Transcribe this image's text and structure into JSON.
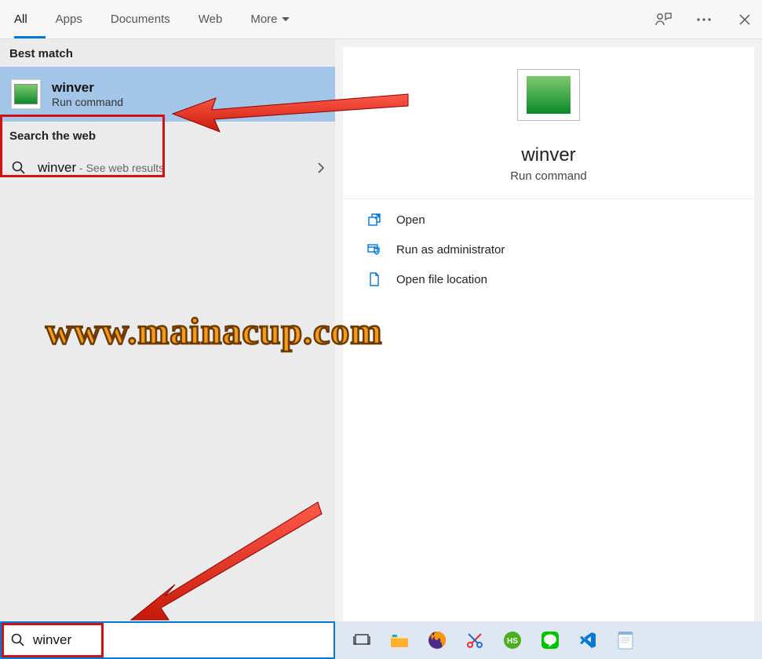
{
  "tabs": {
    "all": "All",
    "apps": "Apps",
    "documents": "Documents",
    "web": "Web",
    "more": "More"
  },
  "sections": {
    "best_match": "Best match",
    "search_web": "Search the web"
  },
  "best_match_item": {
    "title": "winver",
    "subtitle": "Run command"
  },
  "web_result": {
    "term": "winver",
    "suffix": " - See web results"
  },
  "preview": {
    "title": "winver",
    "subtitle": "Run command"
  },
  "actions": {
    "open": "Open",
    "run_admin": "Run as administrator",
    "open_location": "Open file location"
  },
  "search": {
    "value": "winver"
  },
  "watermark": "www.mainacup.com"
}
